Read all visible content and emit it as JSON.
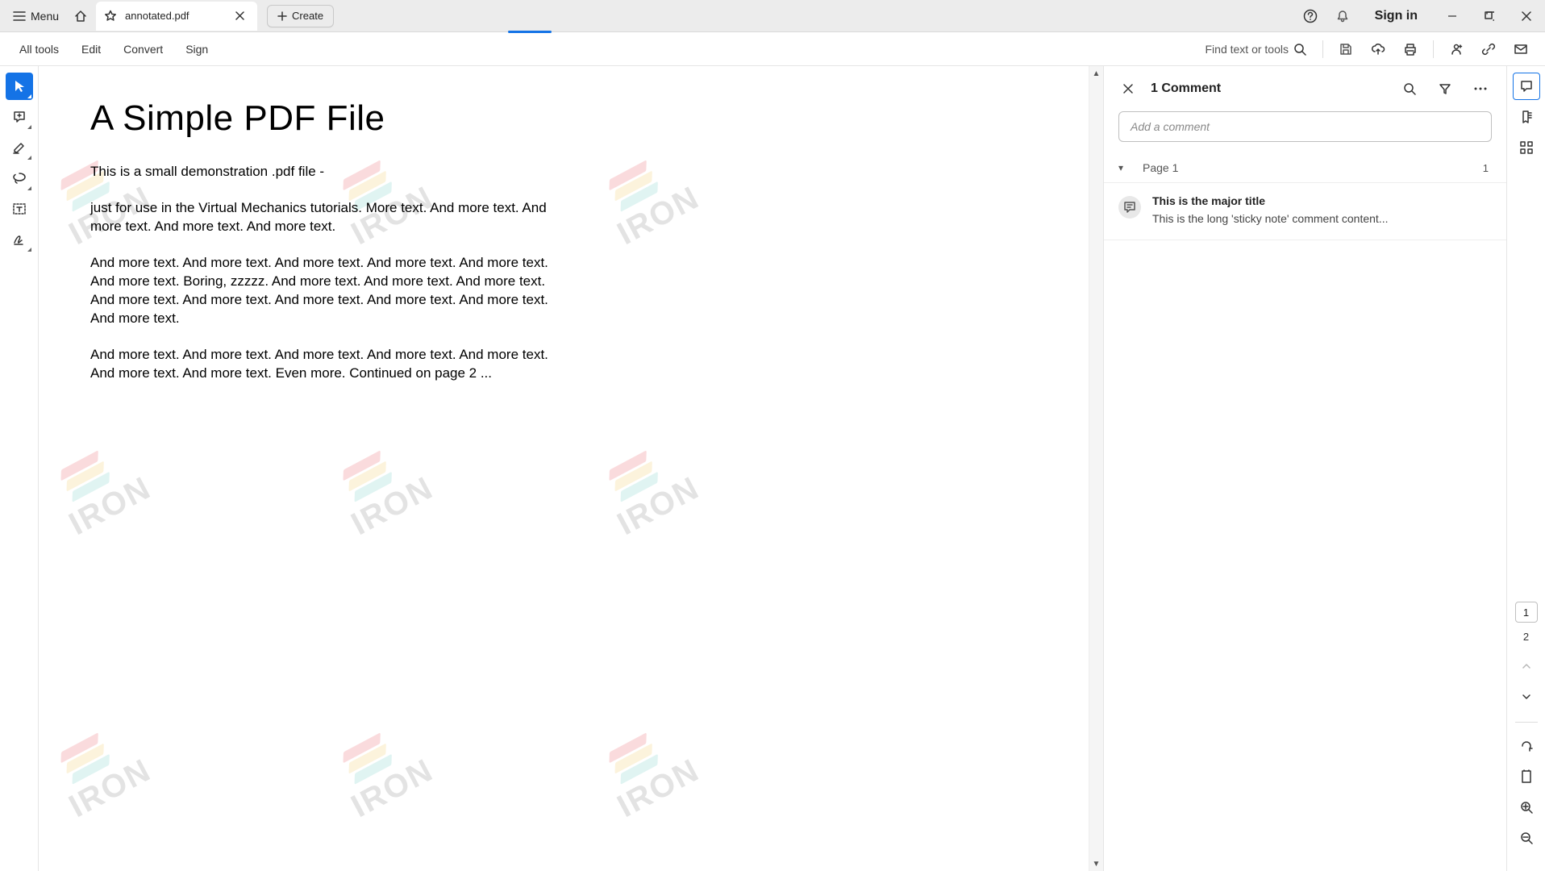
{
  "titlebar": {
    "menu_label": "Menu",
    "tab_title": "annotated.pdf",
    "create_label": "Create",
    "signin_label": "Sign in"
  },
  "toolbar": {
    "items": [
      "All tools",
      "Edit",
      "Convert",
      "Sign"
    ],
    "find_label": "Find text or tools"
  },
  "right_rail": {
    "current_page": "1",
    "total_pages": "2"
  },
  "document": {
    "title": "A Simple PDF File",
    "paragraphs": [
      "This is a small demonstration .pdf file -",
      "just for use in the Virtual Mechanics tutorials. More text. And more text. And more text. And more text. And more text.",
      "And more text. And more text. And more text. And more text. And more text. And more text. Boring, zzzzz. And more text. And more text. And more text. And more text. And more text. And more text. And more text. And more text. And more text.",
      "And more text. And more text. And more text. And more text. And more text. And more text. And more text. Even more. Continued on page 2 ..."
    ],
    "watermark_text": "IRON"
  },
  "comments": {
    "panel_title": "1 Comment",
    "add_placeholder": "Add a comment",
    "page_label": "Page 1",
    "page_count": "1",
    "items": [
      {
        "title": "This is the major title",
        "content": "This is the long 'sticky note' comment content..."
      }
    ]
  }
}
